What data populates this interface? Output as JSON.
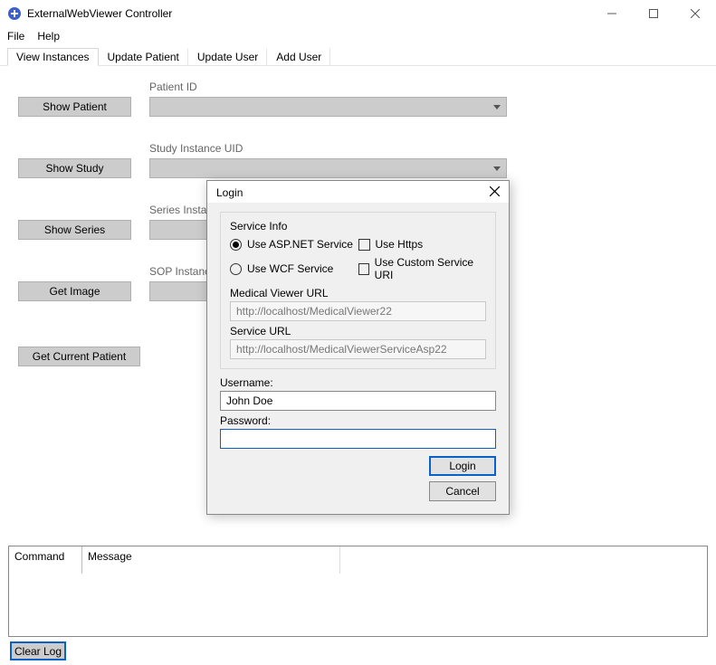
{
  "window": {
    "title": "ExternalWebViewer Controller"
  },
  "menu": {
    "file": "File",
    "help": "Help"
  },
  "tabs": [
    "View Instances",
    "Update Patient",
    "Update User",
    "Add User"
  ],
  "active_tab": 0,
  "main": {
    "rows": [
      {
        "button": "Show Patient",
        "label": "Patient ID"
      },
      {
        "button": "Show Study",
        "label": "Study Instance UID"
      },
      {
        "button": "Show Series",
        "label": "Series Instance UID"
      },
      {
        "button": "Get Image",
        "label": "SOP Instance UID"
      }
    ],
    "get_current": "Get Current Patient"
  },
  "log": {
    "col_command": "Command",
    "col_message": "Message",
    "clear": "Clear Log"
  },
  "dialog": {
    "title": "Login",
    "legend": "Service Info",
    "opt_asp": "Use ASP.NET Service",
    "opt_wcf": "Use WCF Service",
    "opt_https": "Use Https",
    "opt_custom": "Use Custom Service URI",
    "medurl_label": "Medical Viewer URL",
    "medurl_value": "http://localhost/MedicalViewer22",
    "svcurl_label": "Service URL",
    "svcurl_value": "http://localhost/MedicalViewerServiceAsp22",
    "username_label": "Username:",
    "username_value": "John Doe",
    "password_label": "Password:",
    "password_value": "",
    "login_btn": "Login",
    "cancel_btn": "Cancel"
  }
}
